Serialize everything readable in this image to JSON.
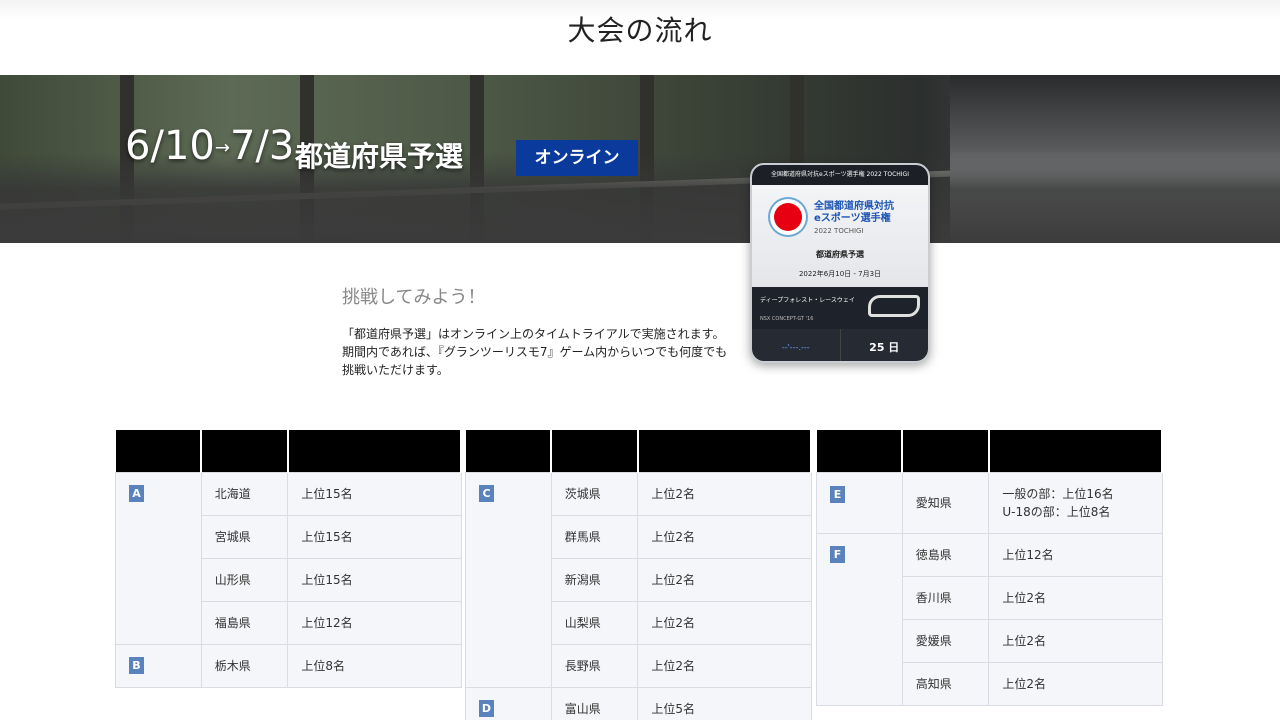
{
  "page": {
    "title": "大会の流れ"
  },
  "banner": {
    "start_month": "6",
    "start_day": "10",
    "arrow": "→",
    "end_month": "7",
    "end_day": "3",
    "qualifier": "都道府県予選",
    "online_label": "オンライン"
  },
  "card": {
    "header": "全国都道府県対抗eスポーツ選手権 2022 TOCHIGI",
    "title_line1": "全国都道府県対抗",
    "title_line2": "eスポーツ選手権",
    "subtitle": "2022 TOCHIGI",
    "round": "都道府県予選",
    "dates": "2022年6月10日 - 7月3日",
    "course": "ディープフォレスト・レースウェイ",
    "car": "NSX CONCEPT-GT '16",
    "time": "--'---.---",
    "days_label": "ランキング更新終了まで",
    "days": "25 日"
  },
  "intro": {
    "heading": "挑戦してみよう！",
    "line1": "「都道府県予選」はオンライン上のタイムトライアルで実施されます。",
    "line2": "期間内であれば、『グランツーリスモ7』ゲーム内からいつでも何度でも挑戦いただけます。"
  },
  "tables": [
    {
      "groups": [
        {
          "letter": "A",
          "rows": [
            {
              "pref": "北海道",
              "slots": "上位15名"
            },
            {
              "pref": "宮城県",
              "slots": "上位15名"
            },
            {
              "pref": "山形県",
              "slots": "上位15名"
            },
            {
              "pref": "福島県",
              "slots": "上位12名"
            }
          ]
        },
        {
          "letter": "B",
          "rows": [
            {
              "pref": "栃木県",
              "slots": "上位8名"
            }
          ]
        }
      ]
    },
    {
      "groups": [
        {
          "letter": "C",
          "rows": [
            {
              "pref": "茨城県",
              "slots": "上位2名"
            },
            {
              "pref": "群馬県",
              "slots": "上位2名"
            },
            {
              "pref": "新潟県",
              "slots": "上位2名"
            },
            {
              "pref": "山梨県",
              "slots": "上位2名"
            },
            {
              "pref": "長野県",
              "slots": "上位2名"
            }
          ]
        },
        {
          "letter": "D",
          "rows": [
            {
              "pref": "富山県",
              "slots": "上位5名"
            }
          ]
        }
      ]
    },
    {
      "groups": [
        {
          "letter": "E",
          "rows": [
            {
              "pref": "愛知県",
              "slots": "一般の部：上位16名",
              "slots2": "U-18の部：上位8名"
            }
          ]
        },
        {
          "letter": "F",
          "rows": [
            {
              "pref": "徳島県",
              "slots": "上位12名"
            },
            {
              "pref": "香川県",
              "slots": "上位2名"
            },
            {
              "pref": "愛媛県",
              "slots": "上位2名"
            },
            {
              "pref": "高知県",
              "slots": "上位2名"
            }
          ]
        }
      ]
    }
  ]
}
